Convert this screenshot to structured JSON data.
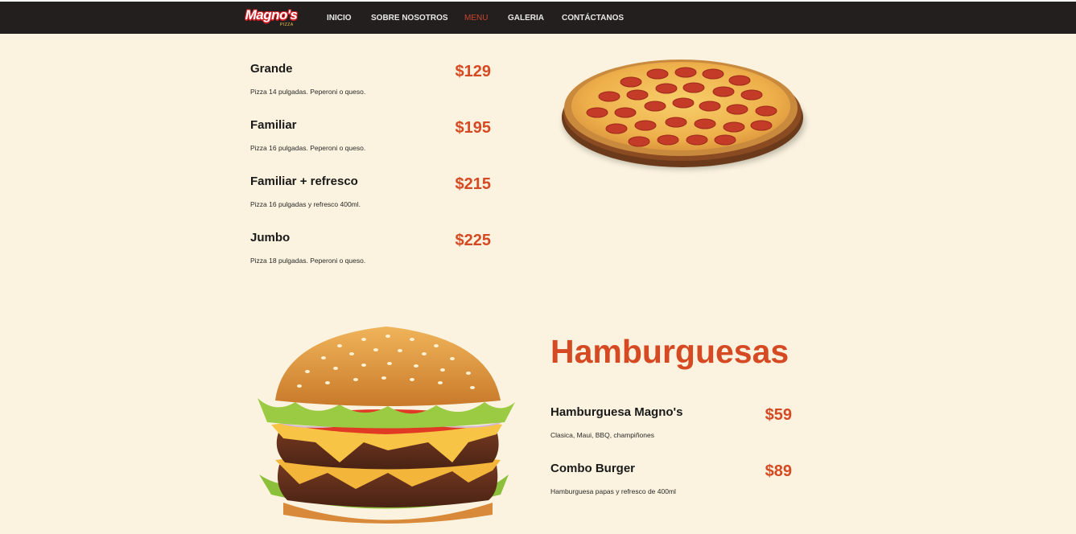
{
  "nav": {
    "logo_text": "Magno's",
    "logo_sub": "PIZZA",
    "items": [
      "INICIO",
      "SOBRE NOSOTROS",
      "MENU",
      "GALERIA",
      "CONTÁCTANOS"
    ],
    "active": "MENU"
  },
  "pizza_menu": {
    "items": [
      {
        "name": "Grande",
        "desc": "Pizza 14 pulgadas. Peperoni o queso.",
        "price": "$129"
      },
      {
        "name": "Familiar",
        "desc": "Pizza 16 pulgadas. Peperoni o queso.",
        "price": "$195"
      },
      {
        "name": "Familiar + refresco",
        "desc": "Pizza 16 pulgadas y refresco 400ml.",
        "price": "$215"
      },
      {
        "name": "Jumbo",
        "desc": "Pizza 18 pulgadas. Peperoni o queso.",
        "price": "$225"
      }
    ]
  },
  "burger_menu": {
    "title": "Hamburguesas",
    "items": [
      {
        "name": "Hamburguesa Magno's",
        "desc": "Clasica, Maui, BBQ, champiñones",
        "price": "$59"
      },
      {
        "name": "Combo Burger",
        "desc": "Hamburguesa papas y refresco de 400ml",
        "price": "$89"
      }
    ]
  },
  "colors": {
    "background": "#fbf3df",
    "navbar": "#221f1e",
    "accent": "#d54a23",
    "active_nav": "#c9462f"
  },
  "images": {
    "pizza": "pepperoni-pizza-image",
    "burger": "double-cheeseburger-image"
  }
}
